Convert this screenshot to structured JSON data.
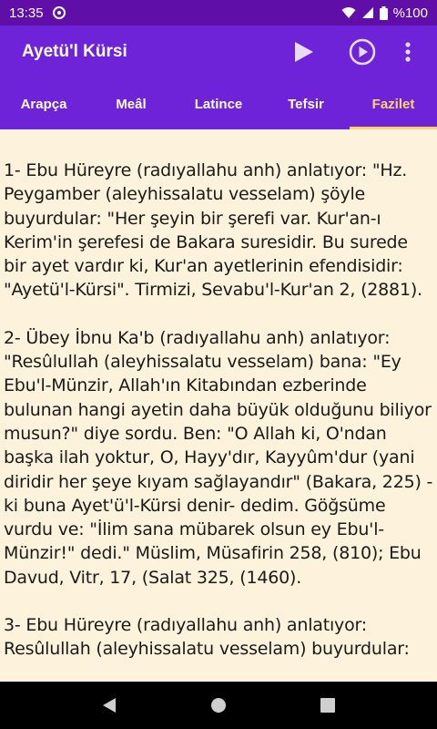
{
  "status_bar": {
    "time": "13:35",
    "battery": "%100"
  },
  "app_bar": {
    "title": "Ayetü'l Kürsi"
  },
  "tabs": [
    {
      "label": "Arapça",
      "active": false
    },
    {
      "label": "Meâl",
      "active": false
    },
    {
      "label": "Latince",
      "active": false
    },
    {
      "label": "Tefsir",
      "active": false
    },
    {
      "label": "Fazilet",
      "active": true
    }
  ],
  "content": {
    "paragraphs": [
      "1- Ebu Hüreyre (radıyallahu anh) anlatıyor: \"Hz. Peygamber (aleyhissalatu vesselam) şöyle buyurdular: \"Her şeyin bir şerefi var. Kur'an-ı Kerim'in şerefesi de Bakara suresidir. Bu surede bir ayet vardır ki, Kur'an ayetlerinin efendisidir: \"Ayetü'l-Kürsi\". Tirmizi, Sevabu'l-Kur'an 2, (2881).",
      "2- Übey İbnu Ka'b (radıyallahu anh) anlatıyor: \"Resûlullah (aleyhissalatu vesselam) bana: \"Ey Ebu'l-Münzir, Allah'ın Kitabından ezberinde bulunan hangi ayetin daha büyük olduğunu biliyor musun?\" diye sordu. Ben: \"O Allah ki, O'ndan başka ilah yoktur, O, Hayy'dır, Kayyûm'dur (yani diridir her şeye kıyam sağlayandır\" (Bakara, 225) -ki buna Ayet'ü'l-Kürsi denir- dedim. Göğsüme vurdu ve: \"İlim sana mübarek olsun ey Ebu'l-Münzir!\" dedi.\" Müslim, Müsafirin 258, (810); Ebu Davud, Vitr, 17, (Salat 325, (1460).",
      "3- Ebu Hüreyre (radıyallahu anh) anlatıyor: Resûlullah (aleyhissalatu vesselam) buyurdular:"
    ]
  },
  "icons": {
    "status": [
      "at-sign-icon",
      "wifi-icon",
      "signal-icon",
      "battery-icon"
    ],
    "actions": [
      "play-icon",
      "play-circle-icon",
      "more-vert-icon"
    ],
    "nav": [
      "back-icon",
      "home-icon",
      "recents-icon"
    ]
  },
  "colors": {
    "status_bar": "#5f0fa8",
    "app_bar": "#6e23d8",
    "active_tab": "#ffd36b",
    "background": "#fdf2db",
    "text": "#1a1a1a"
  }
}
